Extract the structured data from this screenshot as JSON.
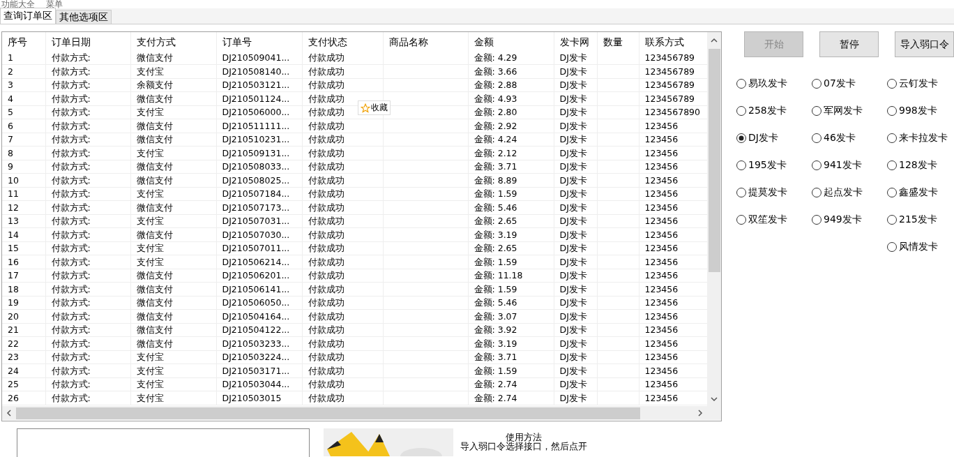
{
  "menu": [
    "功能大全",
    "菜单"
  ],
  "tabs": [
    {
      "label": "查询订单区",
      "selected": true
    },
    {
      "label": "其他选项区",
      "selected": false
    }
  ],
  "table": {
    "columns": [
      "序号",
      "订单日期",
      "支付方式",
      "订单号",
      "支付状态",
      "商品名称",
      "金额",
      "发卡网",
      "数量",
      "联系方式"
    ],
    "rows": [
      [
        "1",
        "付款方式:",
        "微信支付",
        "DJ210509041...",
        "付款成功",
        "",
        "金额: 4.29",
        "DJ发卡",
        "",
        "123456789"
      ],
      [
        "2",
        "付款方式:",
        "支付宝",
        "DJ210508140...",
        "付款成功",
        "",
        "金额: 3.66",
        "DJ发卡",
        "",
        "123456789"
      ],
      [
        "3",
        "付款方式:",
        "余额支付",
        "DJ210503121...",
        "付款成功",
        "",
        "金额: 2.88",
        "DJ发卡",
        "",
        "123456789"
      ],
      [
        "4",
        "付款方式:",
        "微信支付",
        "DJ210501124...",
        "付款成功",
        "",
        "金额: 4.93",
        "DJ发卡",
        "",
        "123456789"
      ],
      [
        "5",
        "付款方式:",
        "支付宝",
        "DJ210506000...",
        "付款成功",
        "",
        "金额: 2.80",
        "DJ发卡",
        "",
        "1234567890"
      ],
      [
        "6",
        "付款方式:",
        "微信支付",
        "DJ210511111...",
        "付款成功",
        "",
        "金额: 2.92",
        "DJ发卡",
        "",
        "123456"
      ],
      [
        "7",
        "付款方式:",
        "微信支付",
        "DJ210510231...",
        "付款成功",
        "",
        "金额: 4.24",
        "DJ发卡",
        "",
        "123456"
      ],
      [
        "8",
        "付款方式:",
        "支付宝",
        "DJ210509131...",
        "付款成功",
        "",
        "金额: 2.12",
        "DJ发卡",
        "",
        "123456"
      ],
      [
        "9",
        "付款方式:",
        "微信支付",
        "DJ210508033...",
        "付款成功",
        "",
        "金额: 3.71",
        "DJ发卡",
        "",
        "123456"
      ],
      [
        "10",
        "付款方式:",
        "微信支付",
        "DJ210508025...",
        "付款成功",
        "",
        "金额: 8.89",
        "DJ发卡",
        "",
        "123456"
      ],
      [
        "11",
        "付款方式:",
        "支付宝",
        "DJ210507184...",
        "付款成功",
        "",
        "金额: 1.59",
        "DJ发卡",
        "",
        "123456"
      ],
      [
        "12",
        "付款方式:",
        "微信支付",
        "DJ210507173...",
        "付款成功",
        "",
        "金额: 5.46",
        "DJ发卡",
        "",
        "123456"
      ],
      [
        "13",
        "付款方式:",
        "支付宝",
        "DJ210507031...",
        "付款成功",
        "",
        "金额: 2.65",
        "DJ发卡",
        "",
        "123456"
      ],
      [
        "14",
        "付款方式:",
        "微信支付",
        "DJ210507030...",
        "付款成功",
        "",
        "金额: 3.19",
        "DJ发卡",
        "",
        "123456"
      ],
      [
        "15",
        "付款方式:",
        "支付宝",
        "DJ210507011...",
        "付款成功",
        "",
        "金额: 2.65",
        "DJ发卡",
        "",
        "123456"
      ],
      [
        "16",
        "付款方式:",
        "支付宝",
        "DJ210506214...",
        "付款成功",
        "",
        "金额: 1.59",
        "DJ发卡",
        "",
        "123456"
      ],
      [
        "17",
        "付款方式:",
        "微信支付",
        "DJ210506201...",
        "付款成功",
        "",
        "金额: 11.18",
        "DJ发卡",
        "",
        "123456"
      ],
      [
        "18",
        "付款方式:",
        "微信支付",
        "DJ210506141...",
        "付款成功",
        "",
        "金额: 1.59",
        "DJ发卡",
        "",
        "123456"
      ],
      [
        "19",
        "付款方式:",
        "微信支付",
        "DJ210506050...",
        "付款成功",
        "",
        "金额: 5.46",
        "DJ发卡",
        "",
        "123456"
      ],
      [
        "20",
        "付款方式:",
        "微信支付",
        "DJ210504164...",
        "付款成功",
        "",
        "金额: 3.07",
        "DJ发卡",
        "",
        "123456"
      ],
      [
        "21",
        "付款方式:",
        "微信支付",
        "DJ210504122...",
        "付款成功",
        "",
        "金额: 3.92",
        "DJ发卡",
        "",
        "123456"
      ],
      [
        "22",
        "付款方式:",
        "微信支付",
        "DJ210503233...",
        "付款成功",
        "",
        "金额: 3.19",
        "DJ发卡",
        "",
        "123456"
      ],
      [
        "23",
        "付款方式:",
        "支付宝",
        "DJ210503224...",
        "付款成功",
        "",
        "金额: 3.71",
        "DJ发卡",
        "",
        "123456"
      ],
      [
        "24",
        "付款方式:",
        "支付宝",
        "DJ210503171...",
        "付款成功",
        "",
        "金额: 1.59",
        "DJ发卡",
        "",
        "123456"
      ],
      [
        "25",
        "付款方式:",
        "支付宝",
        "DJ210503044...",
        "付款成功",
        "",
        "金额: 2.74",
        "DJ发卡",
        "",
        "123456"
      ],
      [
        "26",
        "付款方式:",
        "支付宝",
        "DJ210503015",
        "付款成功",
        "",
        "金额: 2.74",
        "DJ发卡",
        "",
        "123456"
      ]
    ]
  },
  "bookmark_badge": {
    "label": "收藏"
  },
  "buttons": [
    {
      "label": "开始",
      "disabled": true
    },
    {
      "label": "暂停",
      "disabled": false
    },
    {
      "label": "导入弱口令",
      "disabled": false
    }
  ],
  "radio_columns": [
    [
      {
        "label": "易玖发卡",
        "selected": false
      },
      {
        "label": "258发卡",
        "selected": false
      },
      {
        "label": "DJ发卡",
        "selected": true
      },
      {
        "label": "195发卡",
        "selected": false
      },
      {
        "label": "提莫发卡",
        "selected": false
      },
      {
        "label": "双笙发卡",
        "selected": false
      }
    ],
    [
      {
        "label": "07发卡",
        "selected": false
      },
      {
        "label": "军网发卡",
        "selected": false
      },
      {
        "label": "46发卡",
        "selected": false
      },
      {
        "label": "941发卡",
        "selected": false
      },
      {
        "label": "起点发卡",
        "selected": false
      },
      {
        "label": "949发卡",
        "selected": false
      }
    ],
    [
      {
        "label": "云钉发卡",
        "selected": false
      },
      {
        "label": "998发卡",
        "selected": false
      },
      {
        "label": "来卡拉发卡",
        "selected": false
      },
      {
        "label": "128发卡",
        "selected": false
      },
      {
        "label": "鑫盛发卡",
        "selected": false
      },
      {
        "label": "215发卡",
        "selected": false
      },
      {
        "label": "风情发卡",
        "selected": false
      }
    ]
  ],
  "bottom": {
    "help_title": "使用方法",
    "help_text": "导入弱口令选择接口，然后点开"
  }
}
